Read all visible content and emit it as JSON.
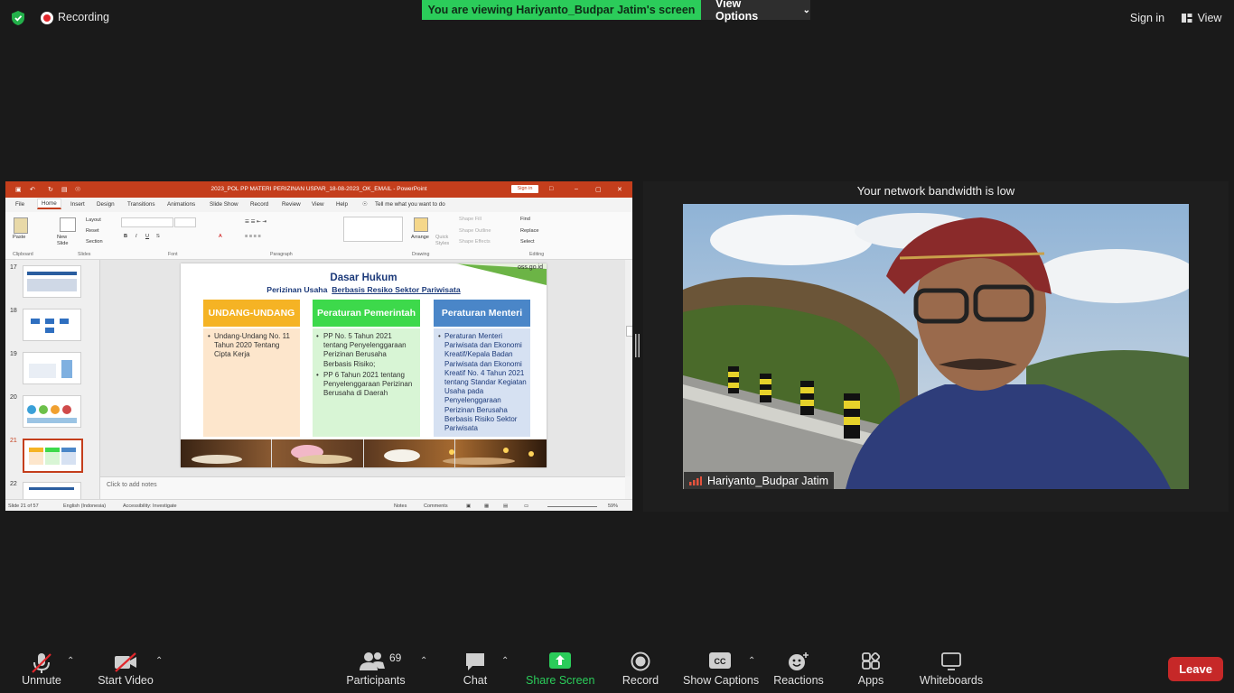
{
  "top_bar": {
    "recording_label": "Recording",
    "viewing_banner": "You are viewing Hariyanto_Budpar Jatim's screen",
    "view_options_label": "View Options",
    "sign_in_label": "Sign in",
    "view_label": "View"
  },
  "ppt": {
    "window_title": "2023_POL PP MATERI PERIZINAN USPAR_18-08-2023_OK_EMAIL  -  PowerPoint",
    "sign_in": "Sign in",
    "tabs": [
      "File",
      "Home",
      "Insert",
      "Design",
      "Transitions",
      "Animations",
      "Slide Show",
      "Record",
      "Review",
      "View",
      "Help"
    ],
    "tell_me": "Tell me what you want to do",
    "ribbon": {
      "paste": "Paste",
      "new_slide": "New Slide",
      "layout": "Layout",
      "reset": "Reset",
      "section": "Section",
      "arrange": "Arrange",
      "quick_styles": "Quick Styles",
      "shape_fill": "Shape Fill",
      "shape_outline": "Shape Outline",
      "shape_effects": "Shape Effects",
      "find": "Find",
      "replace": "Replace",
      "select": "Select",
      "groups": [
        "Clipboard",
        "Slides",
        "Font",
        "Paragraph",
        "Drawing",
        "Editing"
      ]
    },
    "slide_numbers": [
      "17",
      "18",
      "19",
      "20",
      "21",
      "22"
    ],
    "notes_placeholder": "Click to add notes",
    "status": {
      "slide_of": "Slide 21 of 57",
      "language": "English (Indonesia)",
      "accessibility": "Accessibility: Investigate",
      "notes": "Notes",
      "comments": "Comments",
      "zoom": "59%"
    },
    "slide": {
      "title": "Dasar Hukum",
      "subtitle_plain": "Perizinan Usaha  ",
      "subtitle_underlined": "Berbasis Resiko Sektor Pariwisata",
      "site": "oss.go.id",
      "columns": [
        {
          "header": "UNDANG-UNDANG",
          "items": [
            "Undang-Undang No. 11 Tahun 2020 Tentang Cipta Kerja"
          ]
        },
        {
          "header": "Peraturan Pemerintah",
          "items": [
            "PP No. 5 Tahun 2021 tentang Penyelenggaraan Perizinan Berusaha Berbasis Risiko;",
            "PP 6 Tahun 2021 tentang Penyelenggaraan Perizinan Berusaha di Daerah"
          ]
        },
        {
          "header": "Peraturan Menteri",
          "items": [
            "Peraturan Menteri Pariwisata dan Ekonomi Kreatif/Kepala Badan Pariwisata dan Ekonomi Kreatif No. 4 Tahun 2021 tentang Standar Kegiatan Usaha pada Penyelenggaraan Perizinan Berusaha Berbasis Risiko Sektor Pariwisata"
          ]
        }
      ]
    }
  },
  "video": {
    "bandwidth_notice": "Your network bandwidth is low",
    "participant_name": "Hariyanto_Budpar Jatim"
  },
  "toolbar": {
    "unmute": "Unmute",
    "start_video": "Start Video",
    "participants": "Participants",
    "participants_count": "69",
    "chat": "Chat",
    "share_screen": "Share Screen",
    "record": "Record",
    "show_captions": "Show Captions",
    "reactions": "Reactions",
    "apps": "Apps",
    "whiteboards": "Whiteboards",
    "leave": "Leave"
  },
  "colors": {
    "zoom_green": "#2bcc5a",
    "ppt_red": "#c43e1c",
    "leave_red": "#c62828",
    "col1": "#f5b324",
    "col2": "#3dd94b",
    "col3": "#4a86c8"
  }
}
